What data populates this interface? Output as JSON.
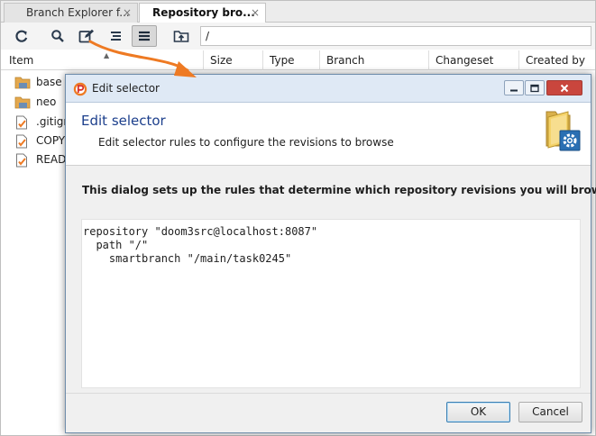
{
  "tabs": [
    {
      "label": "Branch Explorer f...",
      "close": "×"
    },
    {
      "label": "Repository bro...",
      "close": "×"
    }
  ],
  "toolbar": {
    "path": "/",
    "icons": [
      "refresh-icon",
      "search-icon",
      "edit-selector-icon",
      "list-icon",
      "menu-icon",
      "folder-up-icon"
    ]
  },
  "columns": [
    "Item",
    "Size",
    "Type",
    "Branch",
    "Changeset",
    "Created by"
  ],
  "items": [
    {
      "label": "base",
      "icon": "folder-icon"
    },
    {
      "label": "neo",
      "icon": "folder-icon"
    },
    {
      "label": ".gitign",
      "icon": "file-icon"
    },
    {
      "label": "COPYI",
      "icon": "file-icon"
    },
    {
      "label": "READM",
      "icon": "file-icon"
    }
  ],
  "dialog": {
    "title": "Edit selector",
    "header_title": "Edit selector",
    "header_desc": "Edit selector rules to configure the revisions to browse",
    "body_text": "This dialog sets up the rules that determine which repository revisions you will browse.",
    "code_lines": [
      "repository \"doom3src@localhost:8087\"",
      "  path \"/\"",
      "    smartbranch \"/main/task0245\""
    ],
    "ok_label": "OK",
    "cancel_label": "Cancel"
  },
  "colors": {
    "accent": "#ee7a23",
    "title_blue": "#1c3f8c",
    "folder": "#e4a84d"
  }
}
